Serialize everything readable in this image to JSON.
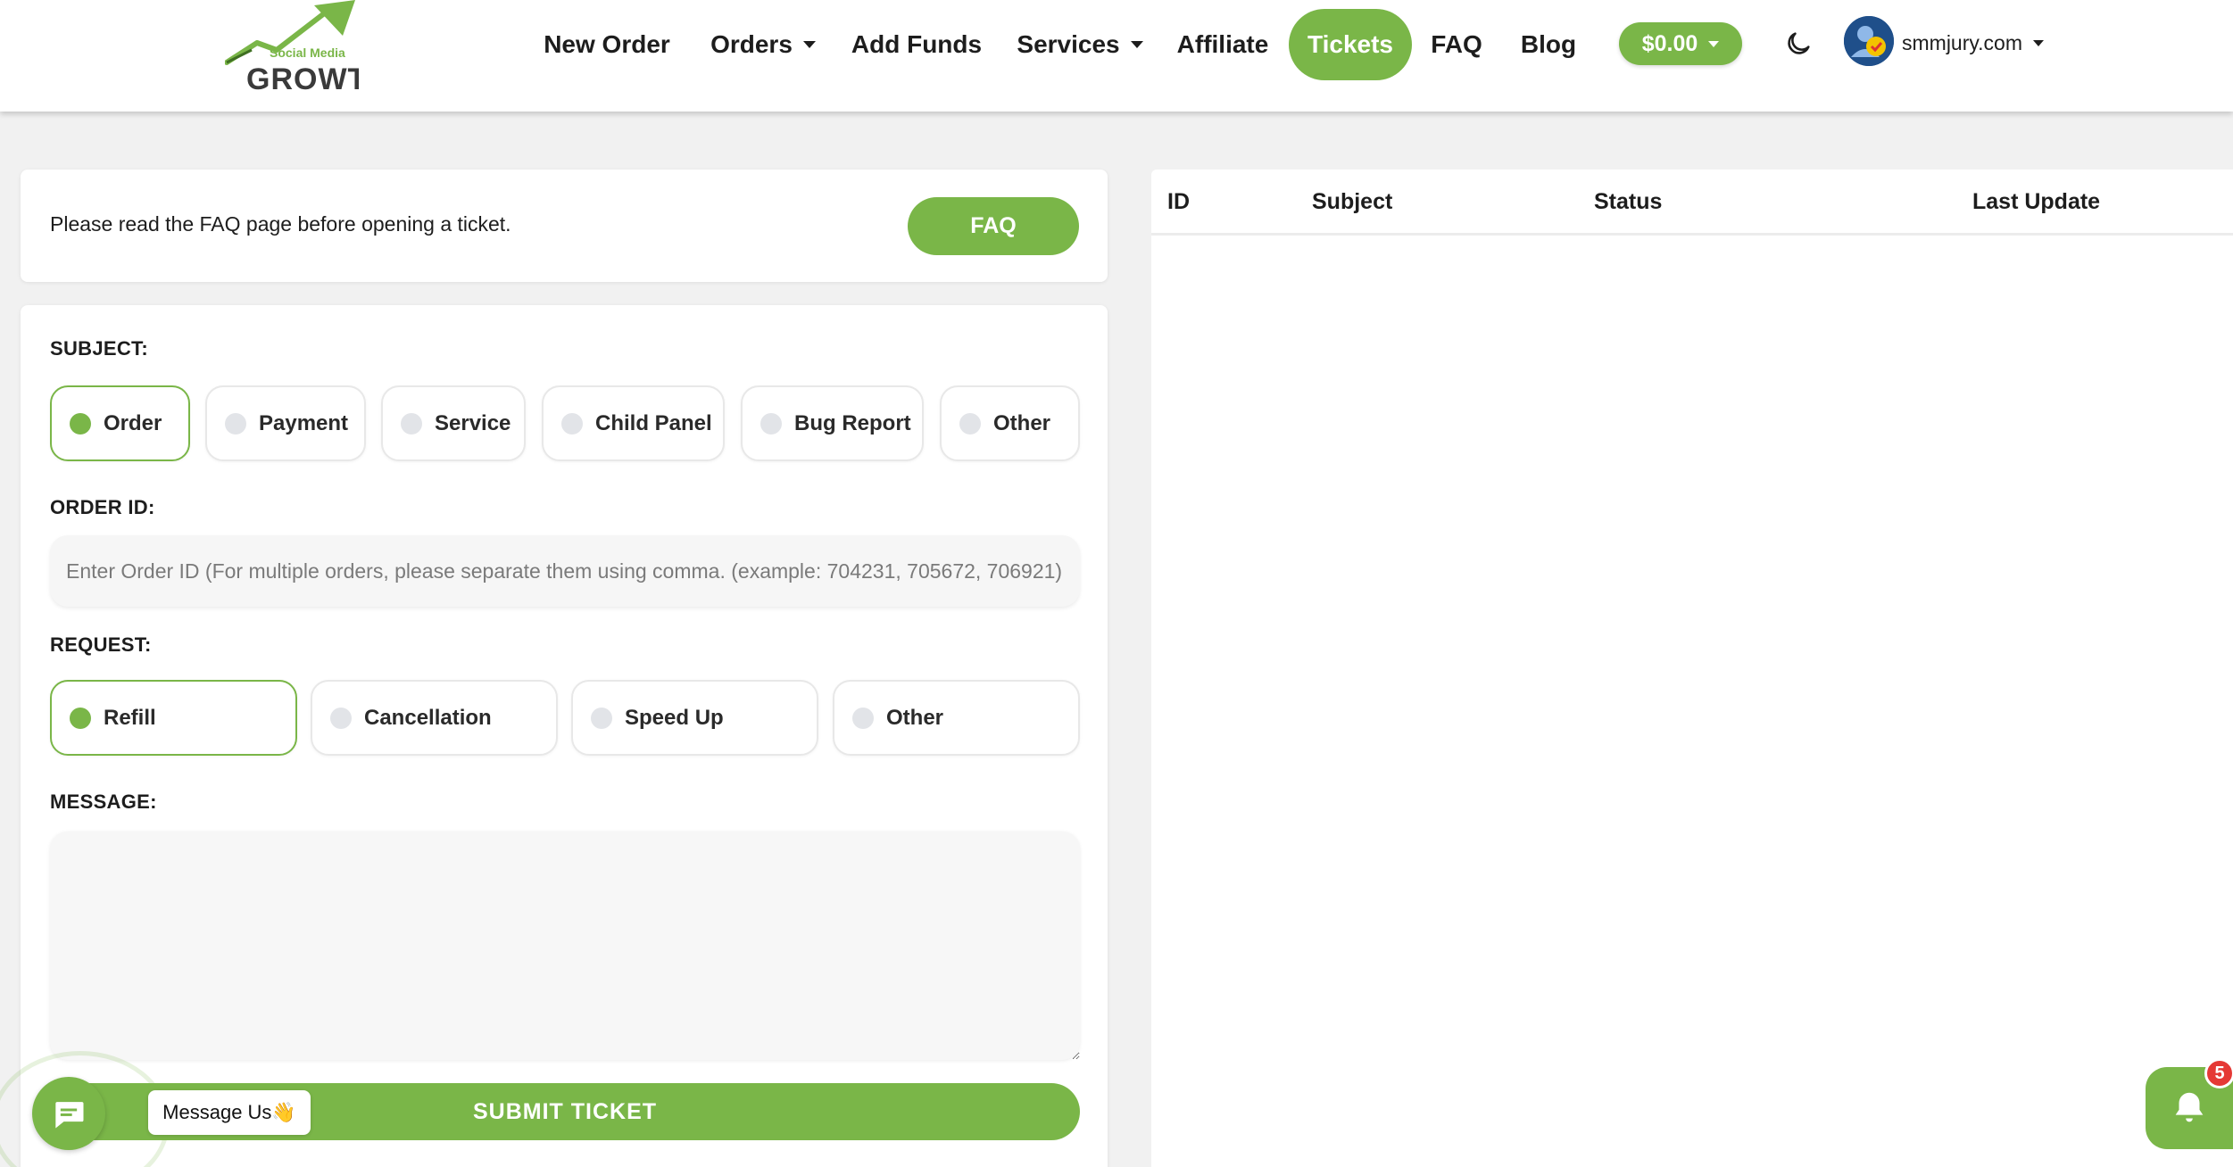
{
  "brand": {
    "logo_text_top": "Social Media",
    "logo_text_bottom": "GROWTH"
  },
  "nav": {
    "items": [
      {
        "label": "New Order"
      },
      {
        "label": "Orders"
      },
      {
        "label": "Add Funds"
      },
      {
        "label": "Services"
      },
      {
        "label": "Affiliate"
      },
      {
        "label": "Tickets"
      },
      {
        "label": "FAQ"
      },
      {
        "label": "Blog"
      }
    ],
    "balance": "$0.00",
    "account": "smmjury.com",
    "theme_toggle_icon": "moon-icon"
  },
  "notice": {
    "text": "Please read the FAQ page before opening a ticket.",
    "button": "FAQ"
  },
  "form": {
    "subject_label": "SUBJECT:",
    "subjects": [
      "Order",
      "Payment",
      "Service",
      "Child Panel",
      "Bug Report",
      "Other"
    ],
    "subject_selected": "Order",
    "order_id_label": "ORDER ID:",
    "order_id_placeholder": "Enter Order ID (For multiple orders, please separate them using comma. (example: 704231, 705672, 706921)",
    "request_label": "REQUEST:",
    "requests": [
      "Refill",
      "Cancellation",
      "Speed Up",
      "Other"
    ],
    "request_selected": "Refill",
    "message_label": "MESSAGE:",
    "submit": "SUBMIT TICKET"
  },
  "tickets_table": {
    "columns": [
      "ID",
      "Subject",
      "Status",
      "Last Update"
    ],
    "rows": []
  },
  "widgets": {
    "chat_label": "Message Us👋",
    "notification_count": "5"
  },
  "colors": {
    "accent": "#7ab648",
    "badge": "#e53935"
  }
}
